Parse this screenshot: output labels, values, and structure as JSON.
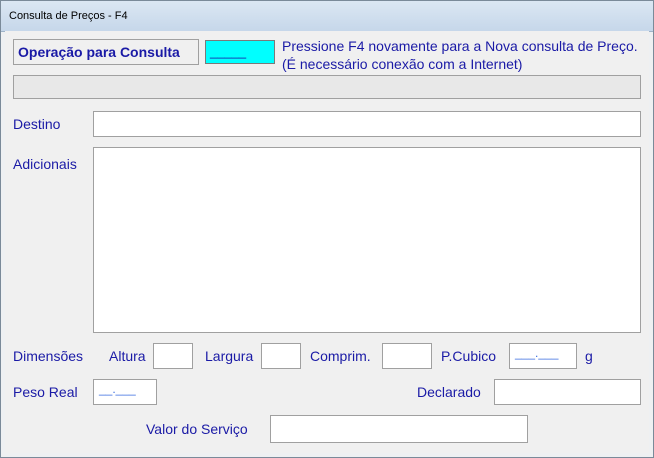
{
  "window": {
    "title": "Consulta de Preços - F4"
  },
  "operation": {
    "label": "Operação para Consulta",
    "value": "_____"
  },
  "info_text": "Pressione F4 novamente para a Nova consulta de Preço. (É necessário conexão com a Internet)",
  "destino": {
    "label": "Destino",
    "value": ""
  },
  "adicionais": {
    "label": "Adicionais",
    "value": ""
  },
  "dimensoes": {
    "label": "Dimensões",
    "altura_label": "Altura",
    "largura_label": "Largura",
    "comprim_label": "Comprim.",
    "pcubico_label": "P.Cubico",
    "pcubico_value": "___.___",
    "unit": "g"
  },
  "peso_real": {
    "label": "Peso Real",
    "value": "__.___"
  },
  "declarado": {
    "label": "Declarado",
    "value": ""
  },
  "valor_servico": {
    "label": "Valor do Serviço",
    "value": ""
  }
}
